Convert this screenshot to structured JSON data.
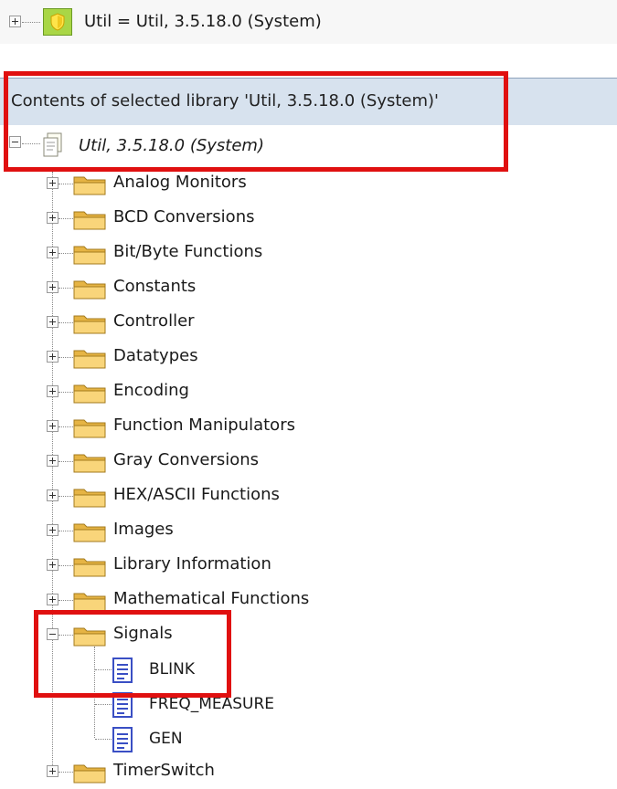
{
  "top_node": {
    "label": "Util = Util, 3.5.18.0 (System)"
  },
  "panel": {
    "header": "Contents of selected library 'Util, 3.5.18.0 (System)'"
  },
  "root_node": {
    "label": "Util, 3.5.18.0 (System)"
  },
  "folders": [
    {
      "label": "Analog Monitors"
    },
    {
      "label": "BCD Conversions"
    },
    {
      "label": "Bit/Byte Functions"
    },
    {
      "label": "Constants"
    },
    {
      "label": "Controller"
    },
    {
      "label": "Datatypes"
    },
    {
      "label": "Encoding"
    },
    {
      "label": "Function Manipulators"
    },
    {
      "label": "Gray Conversions"
    },
    {
      "label": "HEX/ASCII Functions"
    },
    {
      "label": "Images"
    },
    {
      "label": "Library Information"
    },
    {
      "label": "Mathematical Functions"
    },
    {
      "label": "Signals",
      "expanded": true
    },
    {
      "label": "TimerSwitch"
    }
  ],
  "signals_children": [
    {
      "label": "BLINK",
      "icon": "document-icon"
    },
    {
      "label": "FREQ_MEASURE",
      "icon": "document-icon"
    },
    {
      "label": "GEN",
      "icon": "document-icon"
    }
  ],
  "colors": {
    "highlight_box": "#e01010",
    "header_bg": "#d7e2ee",
    "folder": "#f4c766",
    "shield": "#a9d646",
    "document": "#3a4fc4"
  }
}
